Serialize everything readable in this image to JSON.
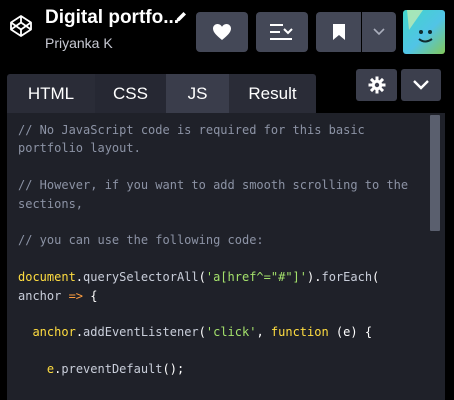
{
  "header": {
    "title": "Digital portfo...",
    "author": "Priyanka K",
    "logo_icon": "codepen-logo-icon",
    "edit_icon": "pencil-icon",
    "buttons": [
      "heart-icon",
      "change-view-icon",
      "bookmark-icon",
      "chevron-down-icon"
    ],
    "avatar_icon": "avatar-face-icon"
  },
  "tabs": {
    "items": [
      {
        "label": "HTML",
        "active": false
      },
      {
        "label": "CSS",
        "active": false
      },
      {
        "label": "JS",
        "active": true
      },
      {
        "label": "Result",
        "active": false
      }
    ],
    "settings_icon": "gear-icon",
    "collapse_icon": "chevron-down-icon"
  },
  "colors": {
    "background": "#000000",
    "button": "#444857",
    "editor_bg": "#1f2129",
    "comment": "#8c93a5",
    "keyword": "#ffdd40",
    "string": "#a3e06b"
  },
  "code": {
    "line1": "// No JavaScript code is required for this basic portfolio layout.",
    "line2": "// However, if you want to add smooth scrolling to the sections,",
    "line3": "// you can use the following code:",
    "line4_obj": "document",
    "line4_dot1": ".",
    "line4_fn1": "querySelectorAll",
    "line4_p1": "(",
    "line4_str": "'a[href^=\"#\"]'",
    "line4_p2": ").",
    "line4_fn2": "forEach",
    "line4_p3": "(",
    "line4_param": "anchor",
    "line4_arrow": " => ",
    "line4_brace": "{",
    "line5_obj": "anchor",
    "line5_dot": ".",
    "line5_fn": "addEventListener",
    "line5_p1": "(",
    "line5_str": "'click'",
    "line5_comma": ", ",
    "line5_kw": "function",
    "line5_args": " (e) {",
    "line6_obj": "e",
    "line6_dot": ".",
    "line6_fn": "preventDefault",
    "line6_end": "();"
  }
}
